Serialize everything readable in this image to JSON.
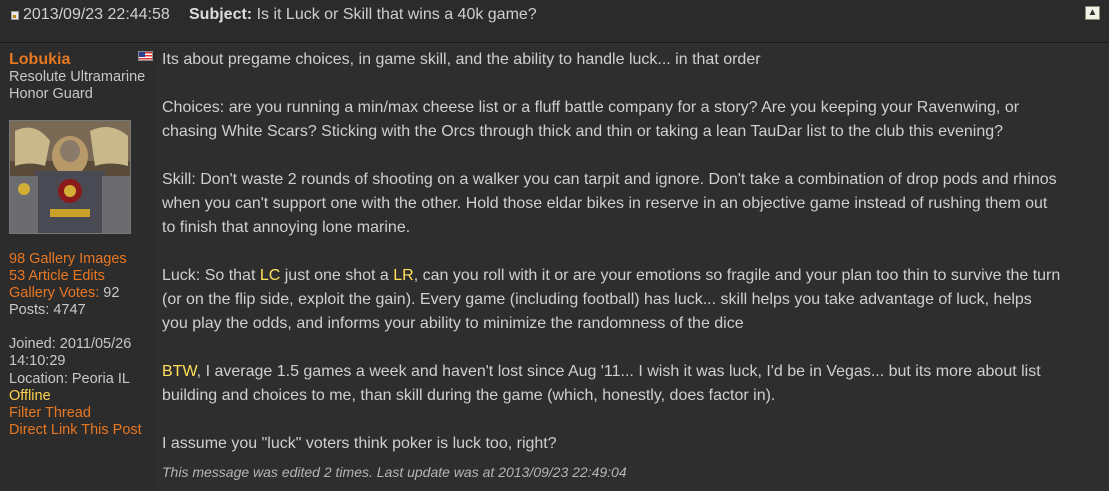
{
  "header": {
    "date": "2013/09/23 22:44:58",
    "subject_label": "Subject:",
    "subject": "Is it Luck or Skill that wins a 40k game?",
    "top_icon": "arrow-up-icon"
  },
  "user": {
    "name": "Lobukia",
    "flag_icon": "us-flag-icon",
    "title_line1": "Resolute Ultramarine",
    "title_line2": "Honor Guard",
    "gallery_images": "98 Gallery Images",
    "article_edits": "53 Article Edits",
    "gallery_votes_label": "Gallery Votes:",
    "gallery_votes_value": "92",
    "posts": "Posts: 4747",
    "joined_label": "Joined: 2011/05/26",
    "joined_time": "14:10:29",
    "location": "Location: Peoria IL",
    "status": "Offline",
    "filter_thread": "Filter Thread",
    "direct_link": "Direct Link This Post"
  },
  "post": {
    "p1": "Its about pregame choices, in game skill, and the ability to handle luck... in that order",
    "p2": "Choices: are you running a min/max cheese list or a fluff battle company for a story? Are you keeping your Ravenwing, or chasing White Scars? Sticking with the Orcs through thick and thin or taking a lean TauDar list to the club this evening?",
    "p3": "Skill: Don't waste 2 rounds of shooting on a walker you can tarpit and ignore. Don't take a combination of drop pods and rhinos when you can't support one with the other. Hold those eldar bikes in reserve in an objective game instead of rushing them out to finish that annoying lone marine.",
    "p4_a": "Luck: So that ",
    "p4_lc": "LC",
    "p4_b": " just one shot a ",
    "p4_lr": "LR",
    "p4_c": ", can you roll with it or are your emotions so fragile and your plan too thin to survive the turn (or on the flip side, exploit the gain). Every game (including football) has luck... skill helps you take advantage of luck, helps you play the odds, and informs your ability to minimize the randomness of the dice",
    "p5_btw": "BTW",
    "p5_rest": ", I average 1.5 games a week and haven't lost since Aug '11... I wish it was luck, I'd be in Vegas... but its more about list building and choices to me, than skill during the game (which, honestly, does factor in).",
    "p6": "I assume you \"luck\" voters think poker is luck too, right?",
    "edit_note": "This message was edited 2 times. Last update was at 2013/09/23 22:49:04"
  }
}
